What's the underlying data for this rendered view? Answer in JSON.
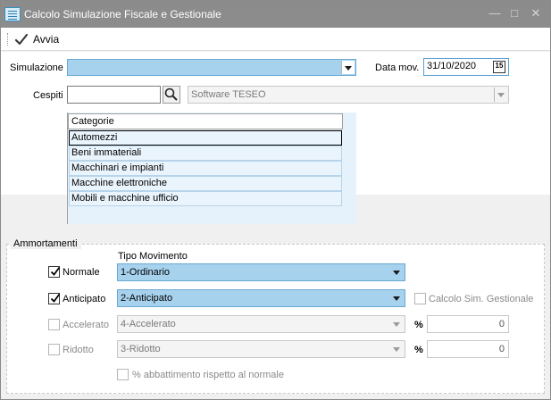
{
  "window": {
    "title": "Calcolo Simulazione Fiscale e Gestionale",
    "minimize": "—",
    "maximize": "□",
    "close": "✕"
  },
  "toolbar": {
    "avvia_label": "Avvia"
  },
  "form": {
    "simulazione_label": "Simulazione",
    "simulazione_value": "",
    "data_mov_label": "Data mov.",
    "data_mov_value": "31/10/2020",
    "calendar_day": "15",
    "cespiti_label": "Cespiti",
    "cespiti_value": "",
    "software_value": "Software TESEO"
  },
  "categories": {
    "header": "Categorie",
    "items": [
      "Automezzi",
      "Beni immateriali",
      "Macchinari e impianti",
      "Macchine elettroniche",
      "Mobili e macchine ufficio"
    ],
    "selected_index": 0
  },
  "ammortamenti": {
    "section_title": "Ammortamenti",
    "tipo_movimento_label": "Tipo Movimento",
    "normale_label": "Normale",
    "normale_checked": true,
    "normale_value": "1-Ordinario",
    "anticipato_label": "Anticipato",
    "anticipato_checked": true,
    "anticipato_value": "2-Anticipato",
    "calcolo_sim_label": "Calcolo Sim. Gestionale",
    "calcolo_sim_checked": false,
    "accelerato_label": "Accelerato",
    "accelerato_checked": false,
    "accelerato_value": "4-Accelerato",
    "accelerato_pct_symbol": "%",
    "accelerato_pct_value": "0",
    "ridotto_label": "Ridotto",
    "ridotto_checked": false,
    "ridotto_value": "3-Ridotto",
    "ridotto_pct_symbol": "%",
    "ridotto_pct_value": "0",
    "abbattimento_label": "% abbattimento rispetto al normale",
    "abbattimento_checked": false
  },
  "colors": {
    "titlebar": "#8c8c8c",
    "combo_highlight": "#a7d2ee",
    "list_background": "#e6f2fb"
  },
  "icons": [
    "app-icon",
    "checkmark-icon",
    "search-icon",
    "calendar-icon",
    "dropdown-arrow-icon",
    "minimize-icon",
    "maximize-icon",
    "close-icon"
  ]
}
